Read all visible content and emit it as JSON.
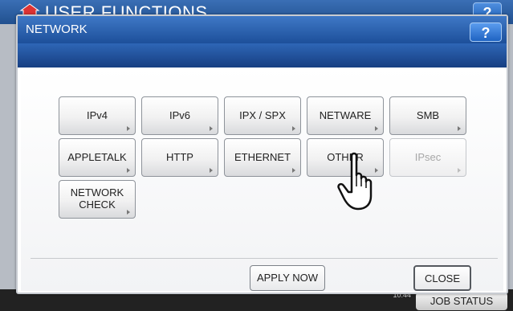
{
  "background": {
    "title": "USER FUNCTIONS",
    "help_label": "?",
    "job_status_label": "JOB STATUS",
    "time": "10:44"
  },
  "dialog": {
    "title": "NETWORK",
    "help_label": "?"
  },
  "functions": [
    {
      "label": "IPv4",
      "enabled": true
    },
    {
      "label": "IPv6",
      "enabled": true
    },
    {
      "label": "IPX / SPX",
      "enabled": true
    },
    {
      "label": "NETWARE",
      "enabled": true
    },
    {
      "label": "SMB",
      "enabled": true
    },
    {
      "label": "APPLETALK",
      "enabled": true
    },
    {
      "label": "HTTP",
      "enabled": true
    },
    {
      "label": "ETHERNET",
      "enabled": true
    },
    {
      "label": "OTHER",
      "enabled": true
    },
    {
      "label": "IPsec",
      "enabled": false
    },
    {
      "label_line1": "NETWORK",
      "label_line2": "CHECK",
      "enabled": true
    }
  ],
  "actions": {
    "apply_now": "APPLY NOW",
    "close": "CLOSE"
  },
  "colors": {
    "titlebar": "#2e66b6",
    "accent_blue": "#1f63c2"
  },
  "icons": [
    "home-icon",
    "help-icon",
    "submenu-arrow-icon",
    "hand-pointer-icon"
  ]
}
